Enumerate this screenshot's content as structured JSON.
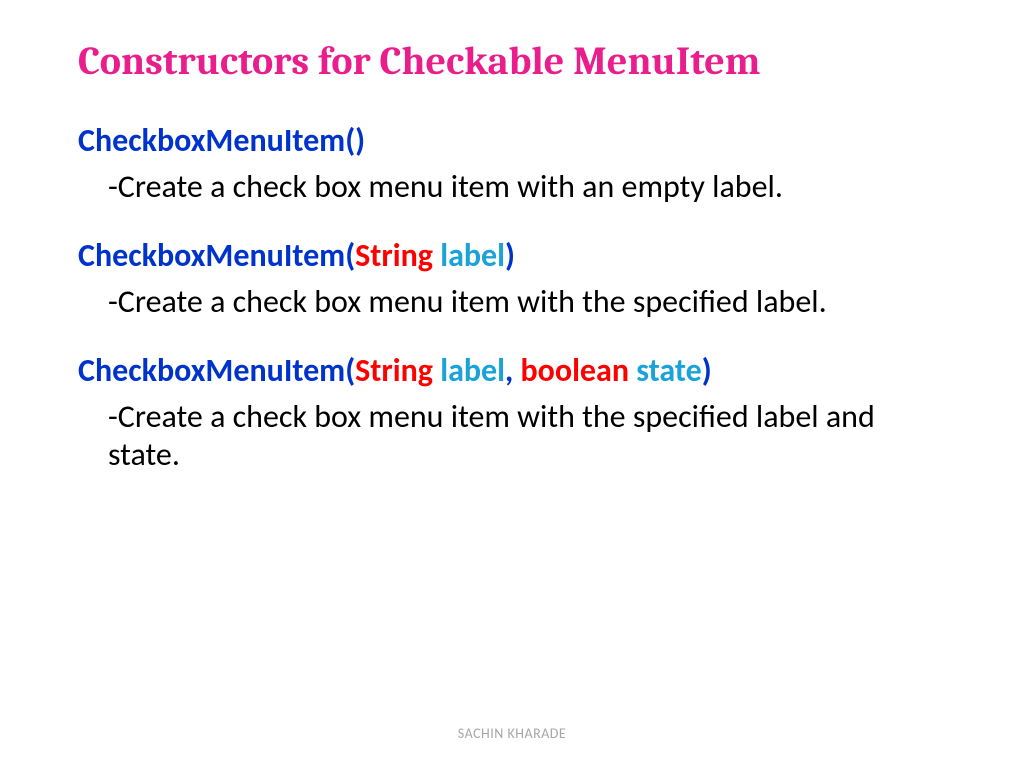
{
  "title": "Constructors for Checkable MenuItem",
  "constructors": [
    {
      "name_open": "CheckboxMenuItem(",
      "params": [],
      "name_close": ")",
      "description": "-Create a check box menu item with an empty label."
    },
    {
      "name_open": "CheckboxMenuItem(",
      "params": [
        {
          "type": "String",
          "ws": "  ",
          "ident": "label"
        }
      ],
      "name_close": ")",
      "description": "-Create a check box menu item with the specified label."
    },
    {
      "name_open": "CheckboxMenuItem(",
      "params": [
        {
          "type": "String",
          "ws": "  ",
          "ident": "label"
        },
        {
          "sep": ", ",
          "type": "boolean",
          "ws": " ",
          "ident": "state"
        }
      ],
      "name_close": ")",
      "description": "-Create a check box menu item with the specified label and state."
    }
  ],
  "footer": "SACHIN KHARADE"
}
